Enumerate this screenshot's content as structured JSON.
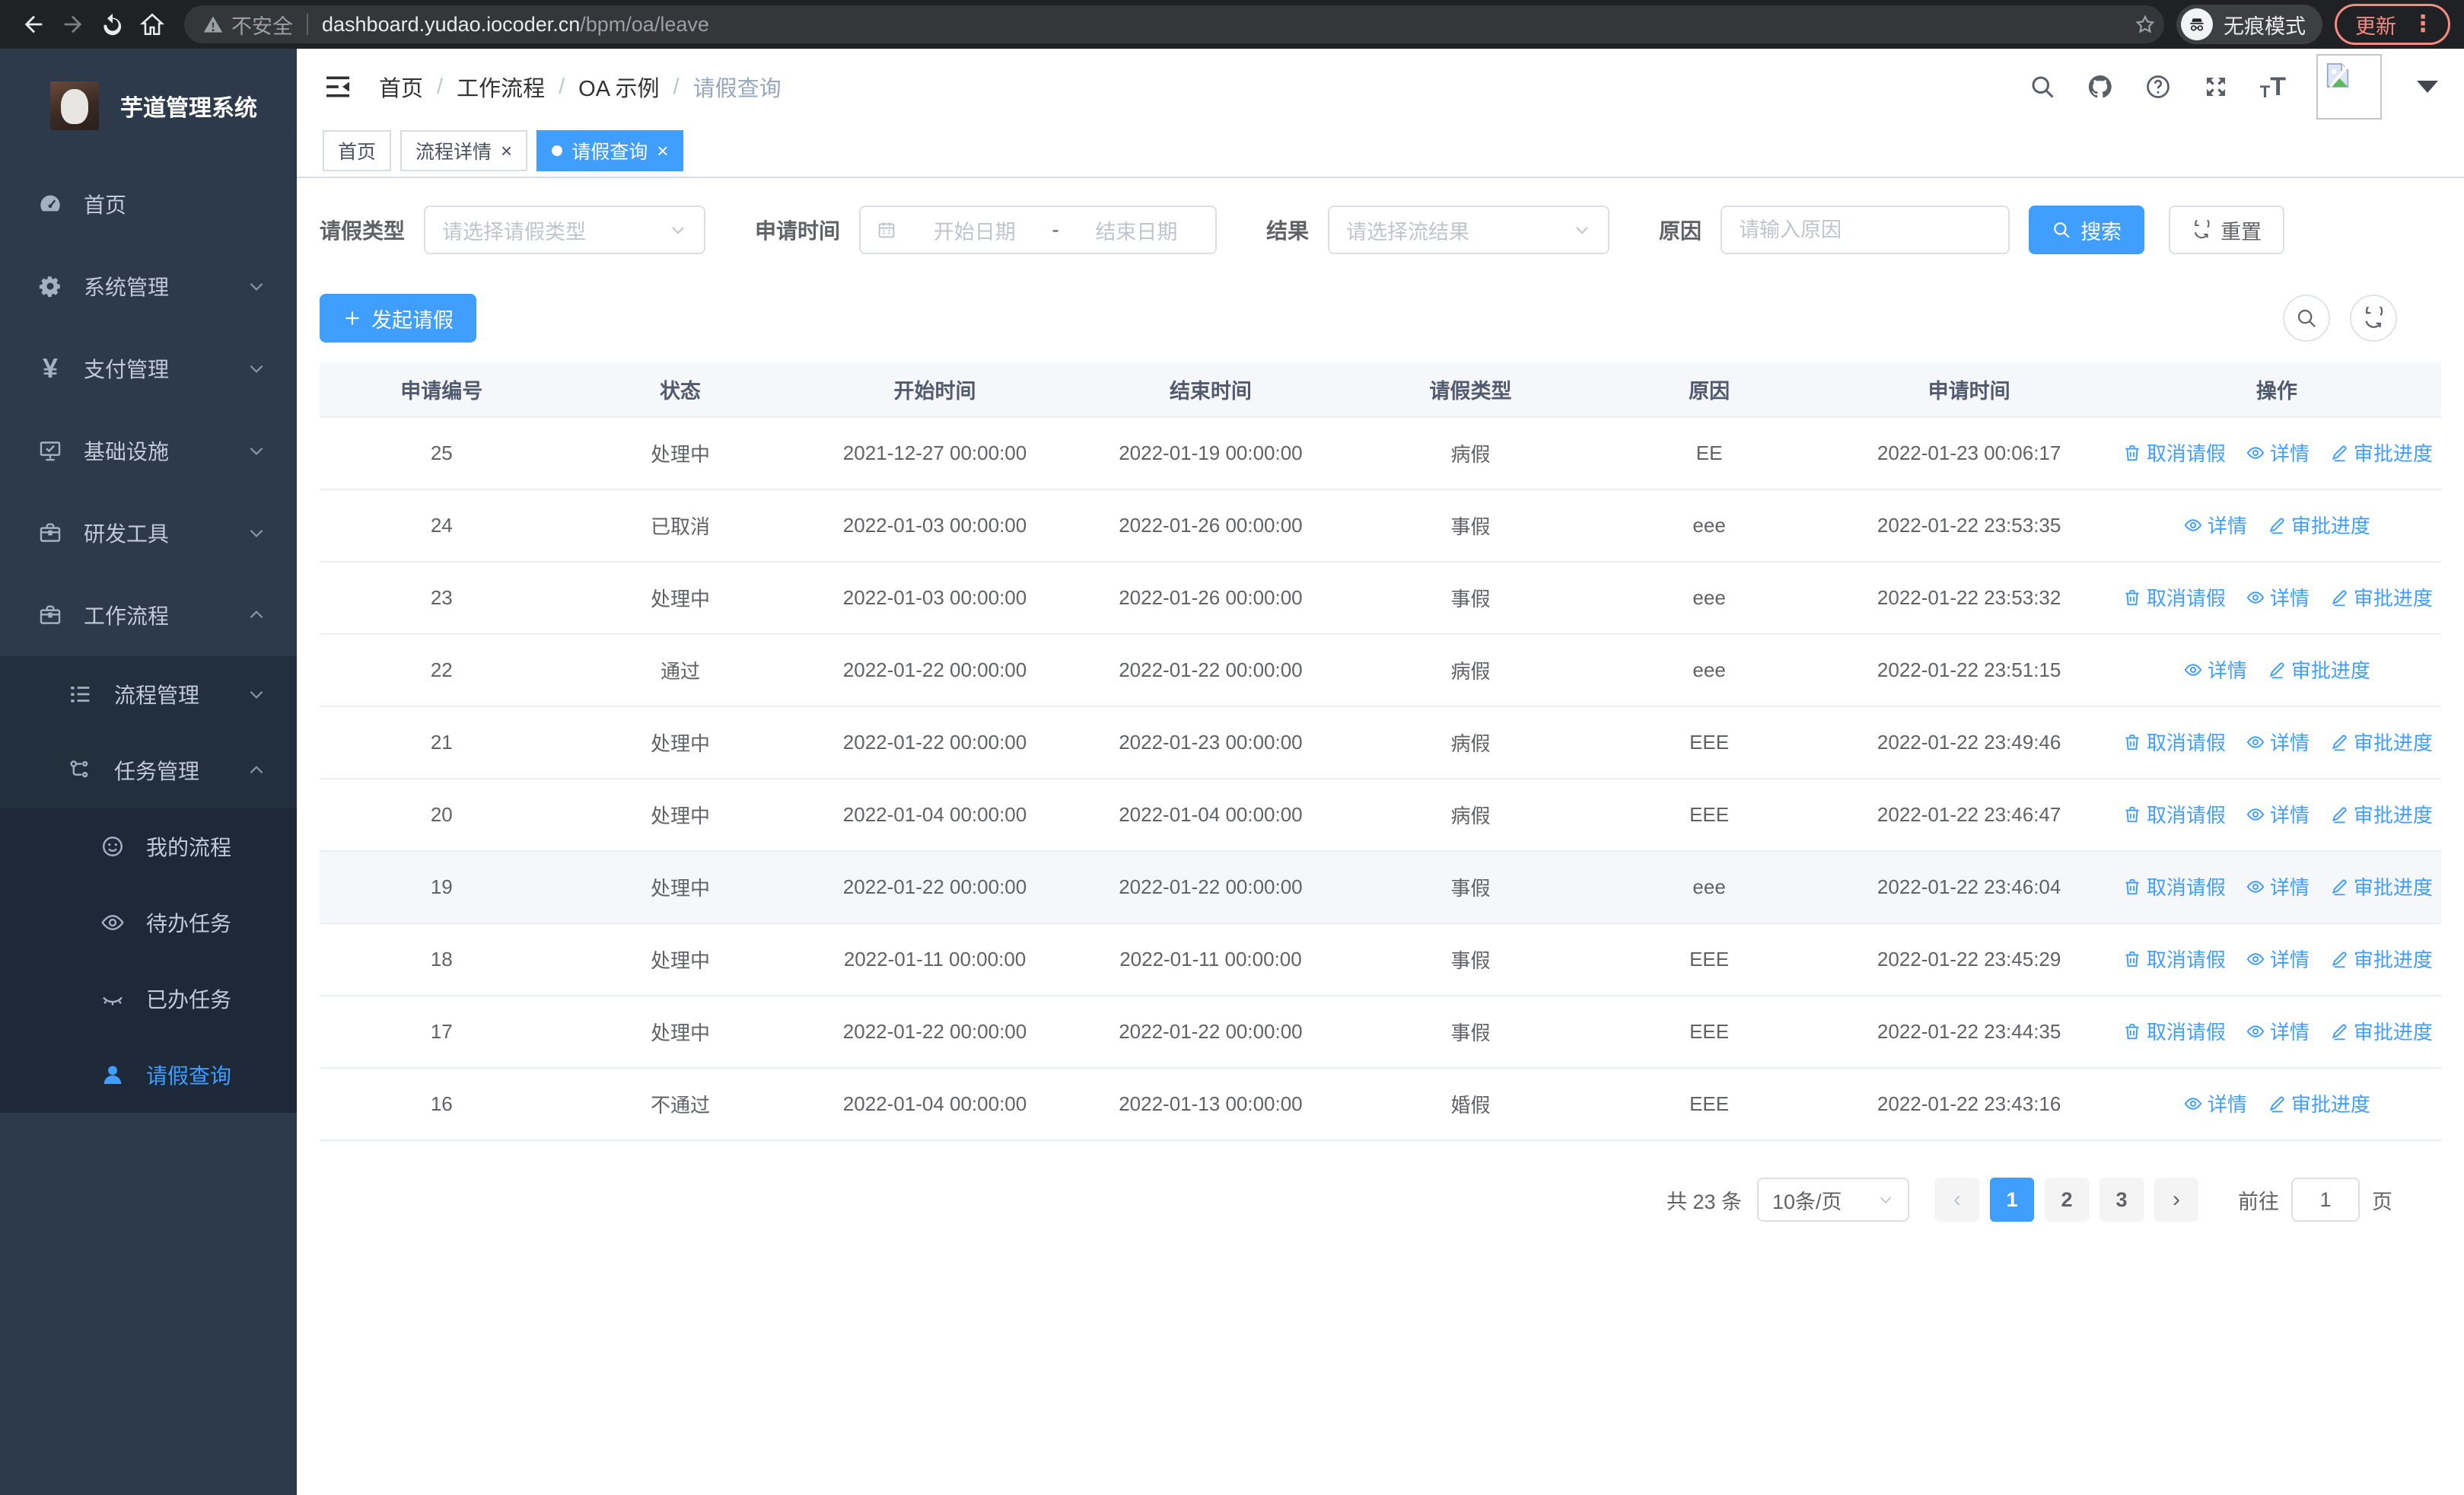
{
  "browser": {
    "security_label": "不安全",
    "url_host": "dashboard.yudao.iocoder.cn",
    "url_path": "/bpm/oa/leave",
    "incognito_label": "无痕模式",
    "update_label": "更新"
  },
  "sidebar": {
    "title": "芋道管理系统",
    "items": [
      {
        "label": "首页"
      },
      {
        "label": "系统管理"
      },
      {
        "label": "支付管理"
      },
      {
        "label": "基础设施"
      },
      {
        "label": "研发工具"
      },
      {
        "label": "工作流程"
      }
    ],
    "submenu": [
      {
        "label": "流程管理"
      },
      {
        "label": "任务管理"
      }
    ],
    "task_items": [
      {
        "label": "我的流程"
      },
      {
        "label": "待办任务"
      },
      {
        "label": "已办任务"
      },
      {
        "label": "请假查询"
      }
    ]
  },
  "header": {
    "breadcrumb": [
      "首页",
      "工作流程",
      "OA 示例",
      "请假查询"
    ],
    "separator": "/",
    "tabs": [
      {
        "label": "首页"
      },
      {
        "label": "流程详情"
      },
      {
        "label": "请假查询"
      }
    ]
  },
  "filters": {
    "leave_type_label": "请假类型",
    "leave_type_placeholder": "请选择请假类型",
    "apply_time_label": "申请时间",
    "start_date_placeholder": "开始日期",
    "range_separator": "-",
    "end_date_placeholder": "结束日期",
    "result_label": "结果",
    "result_placeholder": "请选择流结果",
    "reason_label": "原因",
    "reason_placeholder": "请输入原因",
    "search_label": "搜索",
    "reset_label": "重置"
  },
  "toolbar": {
    "create_label": "发起请假"
  },
  "table": {
    "columns": [
      "申请编号",
      "状态",
      "开始时间",
      "结束时间",
      "请假类型",
      "原因",
      "申请时间",
      "操作"
    ],
    "action_labels": {
      "cancel": "取消请假",
      "detail": "详情",
      "progress": "审批进度"
    },
    "rows": [
      {
        "id": "25",
        "status": "处理中",
        "start": "2021-12-27 00:00:00",
        "end": "2022-01-19 00:00:00",
        "type": "病假",
        "reason": "EE",
        "applied": "2022-01-23 00:06:17",
        "actions": [
          "cancel",
          "detail",
          "progress"
        ]
      },
      {
        "id": "24",
        "status": "已取消",
        "start": "2022-01-03 00:00:00",
        "end": "2022-01-26 00:00:00",
        "type": "事假",
        "reason": "eee",
        "applied": "2022-01-22 23:53:35",
        "actions": [
          "detail",
          "progress"
        ]
      },
      {
        "id": "23",
        "status": "处理中",
        "start": "2022-01-03 00:00:00",
        "end": "2022-01-26 00:00:00",
        "type": "事假",
        "reason": "eee",
        "applied": "2022-01-22 23:53:32",
        "actions": [
          "cancel",
          "detail",
          "progress"
        ]
      },
      {
        "id": "22",
        "status": "通过",
        "start": "2022-01-22 00:00:00",
        "end": "2022-01-22 00:00:00",
        "type": "病假",
        "reason": "eee",
        "applied": "2022-01-22 23:51:15",
        "actions": [
          "detail",
          "progress"
        ]
      },
      {
        "id": "21",
        "status": "处理中",
        "start": "2022-01-22 00:00:00",
        "end": "2022-01-23 00:00:00",
        "type": "病假",
        "reason": "EEE",
        "applied": "2022-01-22 23:49:46",
        "actions": [
          "cancel",
          "detail",
          "progress"
        ]
      },
      {
        "id": "20",
        "status": "处理中",
        "start": "2022-01-04 00:00:00",
        "end": "2022-01-04 00:00:00",
        "type": "病假",
        "reason": "EEE",
        "applied": "2022-01-22 23:46:47",
        "actions": [
          "cancel",
          "detail",
          "progress"
        ]
      },
      {
        "id": "19",
        "status": "处理中",
        "start": "2022-01-22 00:00:00",
        "end": "2022-01-22 00:00:00",
        "type": "事假",
        "reason": "eee",
        "applied": "2022-01-22 23:46:04",
        "actions": [
          "cancel",
          "detail",
          "progress"
        ],
        "highlight": true
      },
      {
        "id": "18",
        "status": "处理中",
        "start": "2022-01-11 00:00:00",
        "end": "2022-01-11 00:00:00",
        "type": "事假",
        "reason": "EEE",
        "applied": "2022-01-22 23:45:29",
        "actions": [
          "cancel",
          "detail",
          "progress"
        ]
      },
      {
        "id": "17",
        "status": "处理中",
        "start": "2022-01-22 00:00:00",
        "end": "2022-01-22 00:00:00",
        "type": "事假",
        "reason": "EEE",
        "applied": "2022-01-22 23:44:35",
        "actions": [
          "cancel",
          "detail",
          "progress"
        ]
      },
      {
        "id": "16",
        "status": "不通过",
        "start": "2022-01-04 00:00:00",
        "end": "2022-01-13 00:00:00",
        "type": "婚假",
        "reason": "EEE",
        "applied": "2022-01-22 23:43:16",
        "actions": [
          "detail",
          "progress"
        ]
      }
    ]
  },
  "pagination": {
    "total": "共 23 条",
    "page_size": "10条/页",
    "pages": [
      "1",
      "2",
      "3"
    ],
    "goto_label": "前往",
    "goto_value": "1",
    "page_label": "页"
  }
}
